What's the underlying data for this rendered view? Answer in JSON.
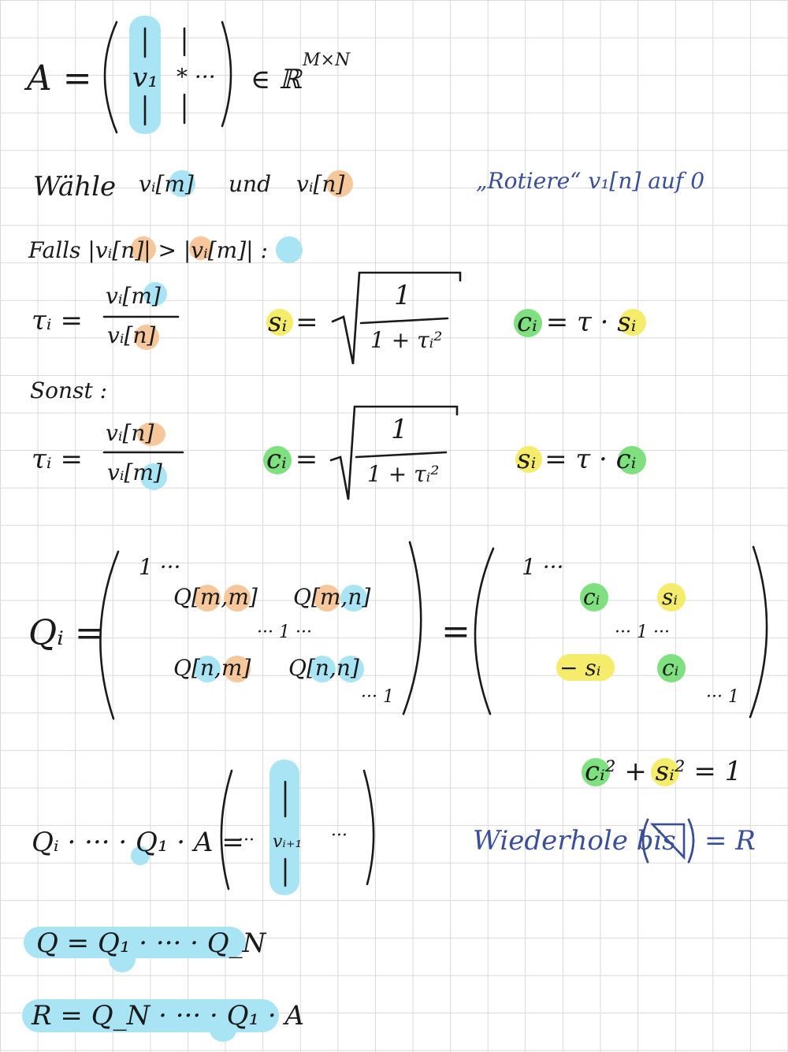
{
  "formula_A": {
    "lhs": "A =",
    "col_v": "v₁",
    "star": "* ···",
    "space": "∈ ℝ",
    "space_exp": "M×N"
  },
  "choose": {
    "text": "Wähle",
    "vim": "vᵢ[m]",
    "und": "und",
    "vin": "vᵢ[n]"
  },
  "note_rotate": "„Rotiere“ v₁[n] auf 0",
  "case1": {
    "cond": "Falls |vᵢ[n]| > |vᵢ[m]| :",
    "tau_lhs": "τᵢ  =",
    "tau_num": "vᵢ[m]",
    "tau_den": "vᵢ[n]",
    "s_lhs": "sᵢ =",
    "sqrt_num": "1",
    "sqrt_den": "1 + τᵢ²",
    "c_expr": "cᵢ = τ · sᵢ"
  },
  "case2": {
    "cond": "Sonst :",
    "tau_lhs": "τᵢ  =",
    "tau_num": "vᵢ[n]",
    "tau_den": "vᵢ[m]",
    "c_lhs": "cᵢ =",
    "sqrt_num": "1",
    "sqrt_den": "1 + τᵢ²",
    "s_expr": "sᵢ = τ · cᵢ"
  },
  "Q_matrix": {
    "lhs": "Qᵢ =",
    "one_tl": "1 ···",
    "qmm": "Q[m,m]",
    "qmn": "Q[m,n]",
    "mid_one": "··· 1 ···",
    "qnm": "Q[n,m]",
    "qnn": "Q[n,n]",
    "one_br": "··· 1",
    "eq": "=",
    "r_one_tl": "1 ···",
    "r_c1": "cᵢ",
    "r_s1": "sᵢ",
    "r_mid": "··· 1 ···",
    "r_neg_s": "− sᵢ",
    "r_c2": "cᵢ",
    "r_one_br": "··· 1"
  },
  "identity": "cᵢ² + sᵢ² = 1",
  "product": {
    "lhs": "Qᵢ · ··· · Q₁ · A =",
    "dots_l": "···",
    "col": "vᵢ₊₁",
    "dots_r": "···"
  },
  "repeat_note": {
    "text": "Wiederhole bis",
    "tail": "= R"
  },
  "Q_def": "Q = Q₁ · ··· · Q_N",
  "R_def": "R = Q_N · ··· · Q₁ · A",
  "colors": {
    "cyan": "#a9e4f5",
    "orange": "#f6c79a",
    "yellow": "#f4ec6a",
    "green": "#7ee07e",
    "ink": "#1a1a1a",
    "blue_ink": "#3a4f9a"
  }
}
